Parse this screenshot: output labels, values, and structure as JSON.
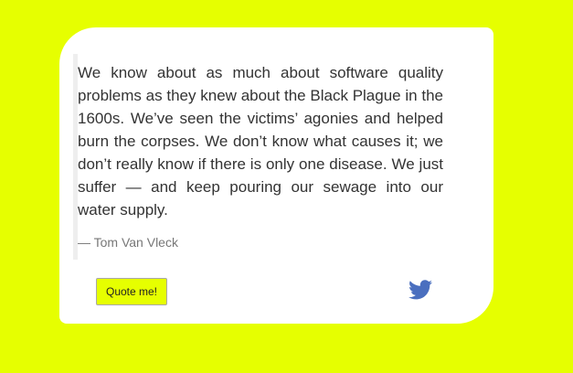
{
  "quote": {
    "text": "We know about as much about software quality problems as they knew about the Black Plague in the 1600s. We’ve seen the victims’ agonies and helped burn the corpses. We don’t know what causes it; we don’t really know if there is only one disease. We just suffer — and keep pouring our sewage into our water supply.",
    "author": "— Tom Van Vleck"
  },
  "actions": {
    "quote_button_label": "Quote me!",
    "twitter_icon": "twitter-bird-icon"
  },
  "colors": {
    "background": "#e6ff00",
    "card": "#ffffff",
    "twitter": "#4a6fbf"
  }
}
